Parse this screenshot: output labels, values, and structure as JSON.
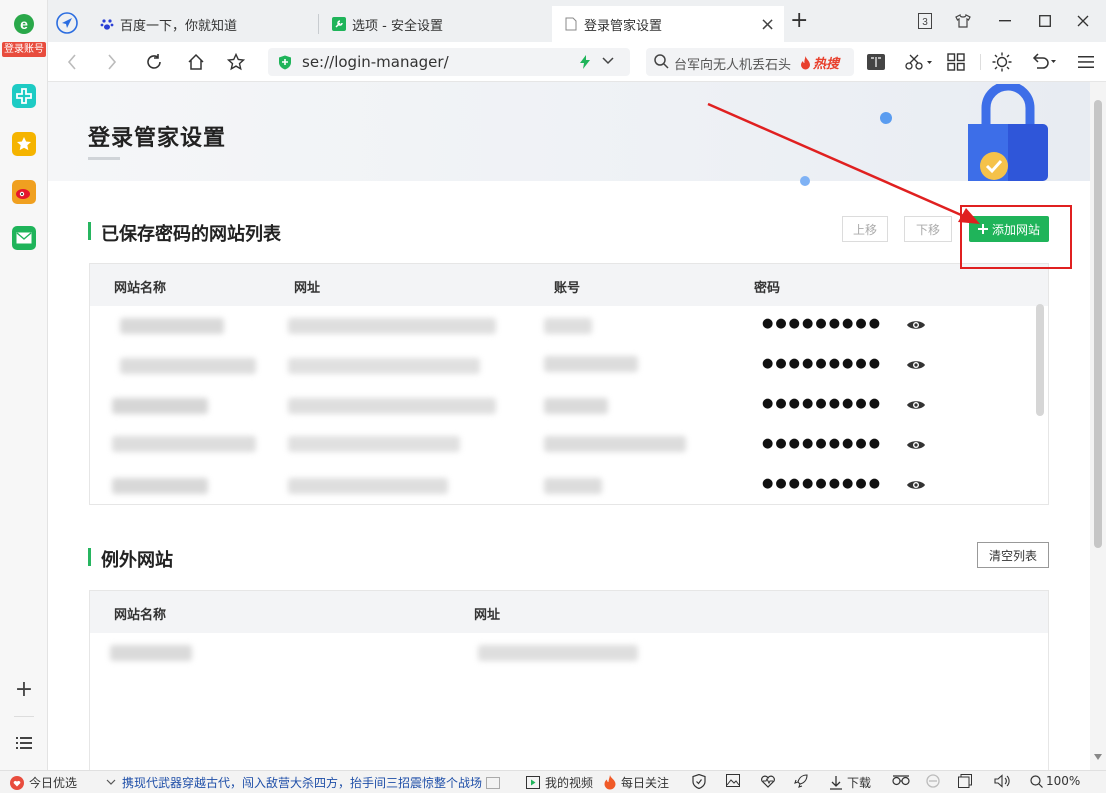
{
  "sidebar": {
    "badge": "登录账号",
    "icons": [
      "medical-cross-icon",
      "star-icon",
      "weibo-icon",
      "mail-icon"
    ],
    "add": "+",
    "list": "☰"
  },
  "tabs": [
    {
      "label": "百度一下，你就知道",
      "icon": "paw-icon"
    },
    {
      "label": "选项 - 安全设置",
      "icon": "wrench-icon"
    },
    {
      "label": "登录管家设置",
      "icon": "page-icon"
    }
  ],
  "tab_close": "×",
  "new_tab": "+",
  "window": {
    "tab_count": "3"
  },
  "address": {
    "url": "se://login-manager/",
    "search_placeholder": "台军向无人机丢石头",
    "hot_label": "热搜"
  },
  "page": {
    "title": "登录管家设置",
    "saved_section": {
      "title": "已保存密码的网站列表",
      "up_button": "上移",
      "down_button": "下移",
      "add_button": "添加网站",
      "columns": [
        "网站名称",
        "网址",
        "账号",
        "密码"
      ],
      "rows": [
        {
          "password": "●●●●●●●●●"
        },
        {
          "password": "●●●●●●●●●"
        },
        {
          "password": "●●●●●●●●●"
        },
        {
          "password": "●●●●●●●●●"
        },
        {
          "password": "●●●●●●●●●"
        }
      ]
    },
    "exception_section": {
      "title": "例外网站",
      "clear_button": "清空列表",
      "columns": [
        "网站名称",
        "网址"
      ]
    }
  },
  "status": {
    "today_pick": "今日优选",
    "news": "携现代武器穿越古代，闯入敌营大杀四方，抬手间三招震惊整个战场",
    "my_video": "我的视频",
    "daily_follow": "每日关注",
    "download": "下载",
    "zoom": "100%"
  },
  "colors": {
    "accent_green": "#1fb45a",
    "annotation_red": "#e02020",
    "badge_red": "#e84c3d"
  }
}
